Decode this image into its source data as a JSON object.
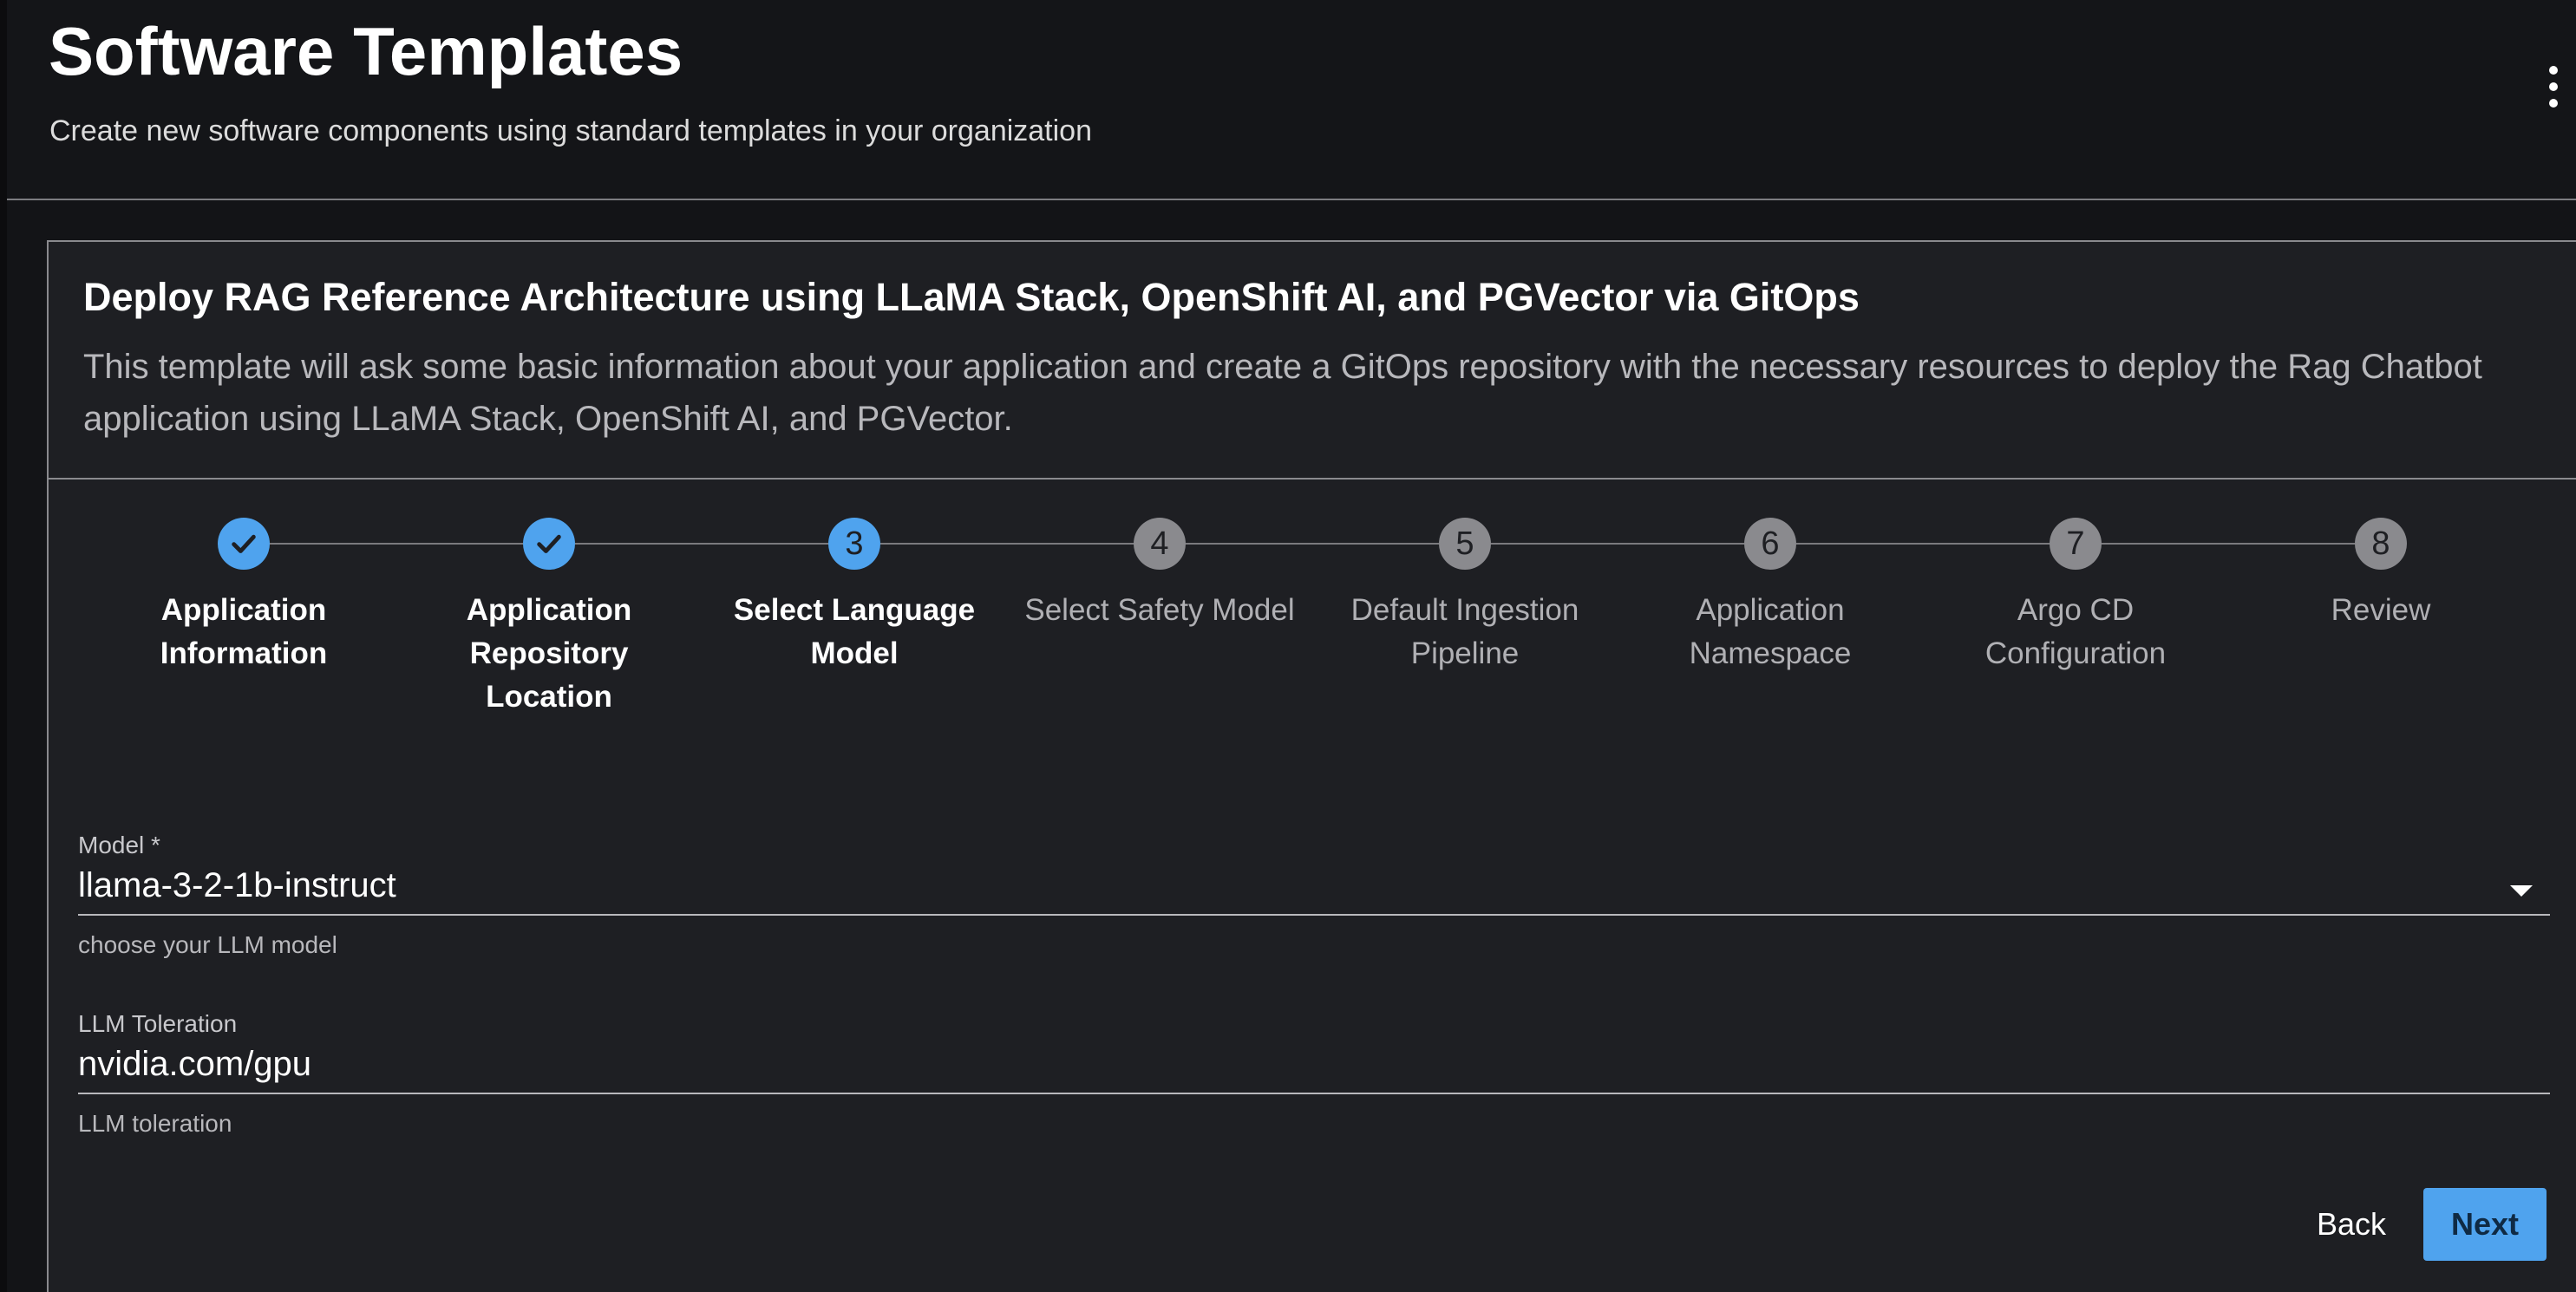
{
  "header": {
    "title": "Software Templates",
    "subtitle": "Create new software components using standard templates in your organization"
  },
  "card": {
    "title": "Deploy RAG Reference Architecture using LLaMA Stack, OpenShift AI, and PGVector via GitOps",
    "description": "This template will ask some basic information about your application and create a GitOps repository with the necessary resources to deploy the Rag Chatbot application using LLaMA Stack, OpenShift AI, and PGVector."
  },
  "steps": [
    {
      "number": "1",
      "label": "Application Information",
      "status": "done"
    },
    {
      "number": "2",
      "label": "Application Repository Location",
      "status": "done"
    },
    {
      "number": "3",
      "label": "Select Language Model",
      "status": "current"
    },
    {
      "number": "4",
      "label": "Select Safety Model",
      "status": "pending"
    },
    {
      "number": "5",
      "label": "Default Ingestion Pipeline",
      "status": "pending"
    },
    {
      "number": "6",
      "label": "Application Namespace",
      "status": "pending"
    },
    {
      "number": "7",
      "label": "Argo CD Configuration",
      "status": "pending"
    },
    {
      "number": "8",
      "label": "Review",
      "status": "pending"
    }
  ],
  "form": {
    "model": {
      "label": "Model *",
      "value": "llama-3-2-1b-instruct",
      "help": "choose your LLM model"
    },
    "toleration": {
      "label": "LLM Toleration",
      "value": "nvidia.com/gpu",
      "help": "LLM toleration"
    }
  },
  "actions": {
    "back_label": "Back",
    "next_label": "Next"
  },
  "colors": {
    "accent": "#4fa3ee",
    "pending": "#8a8a8e",
    "background": "#131417",
    "card": "#1e1f23"
  }
}
